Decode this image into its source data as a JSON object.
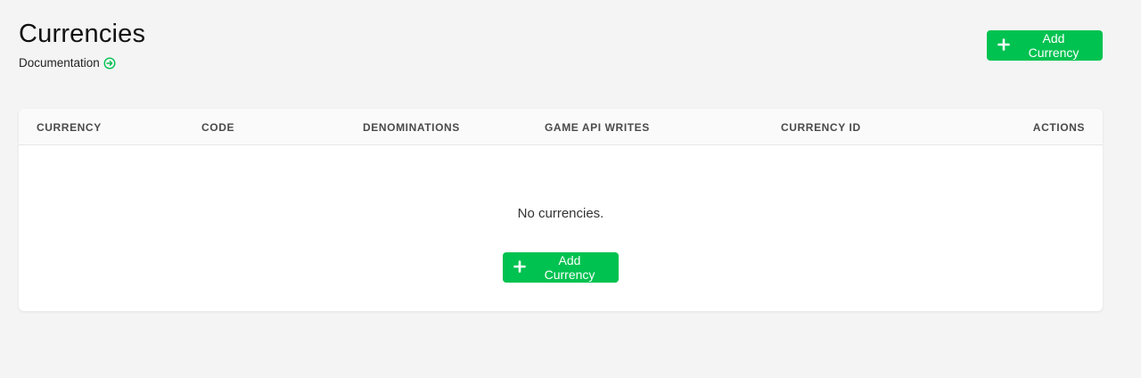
{
  "header": {
    "title": "Currencies",
    "documentation_label": "Documentation"
  },
  "toolbar": {
    "add_currency_label": "Add Currency"
  },
  "table": {
    "columns": [
      "CURRENCY",
      "CODE",
      "DENOMINATIONS",
      "GAME API WRITES",
      "CURRENCY ID",
      "ACTIONS"
    ],
    "empty_message": "No currencies.",
    "empty_add_label": "Add Currency"
  },
  "colors": {
    "accent": "#00c250",
    "background": "#f4f4f4",
    "card": "#ffffff"
  },
  "icons": {
    "documentation": "arrow-circle-right-icon",
    "add": "plus-icon"
  }
}
